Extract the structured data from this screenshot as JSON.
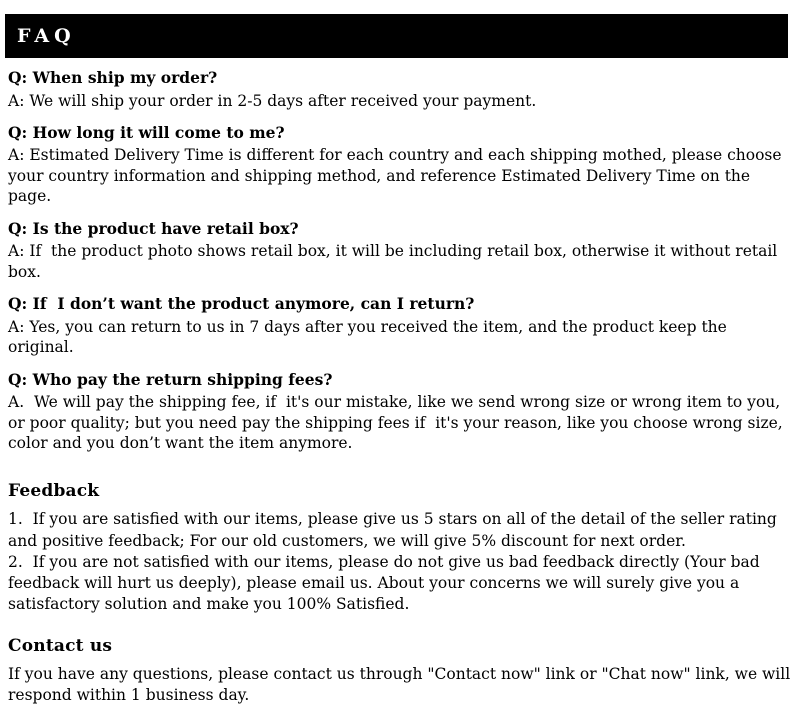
{
  "header": {
    "title": "FAQ",
    "background_color": "#000000",
    "text_color": "#ffffff"
  },
  "faq": {
    "items": [
      {
        "question": "Q: When ship my order?",
        "answer": "A: We will ship your order in 2-5 days after received your payment."
      },
      {
        "question": "Q: How long it will come to me?",
        "answer": "A: Estimated Delivery Time is different for each country and each shipping mothed, please choose your country information and shipping method, and reference Estimated Delivery Time on the page."
      },
      {
        "question": "Q: Is the product have retail box?",
        "answer": "A: If  the product photo shows retail box, it will be including retail box, otherwise it without retail box."
      },
      {
        "question": "Q: If  I don’t want the product anymore, can I return?",
        "answer": "A: Yes, you can return to us in 7 days after you received the item, and the product keep the original."
      },
      {
        "question": "Q: Who pay the return shipping fees?",
        "answer": "A.  We will pay the shipping fee, if  it's our mistake, like we send wrong size or wrong item to you, or poor quality; but you need pay the shipping fees if  it's your reason, like you choose wrong size, color and you don’t want the item anymore."
      }
    ]
  },
  "feedback": {
    "heading": "Feedback",
    "point_one": "1.  If you are satisfied with our items, please give us 5 stars on all of the detail of the seller rating and positive feedback; For our old customers, we will give 5% discount for next order.",
    "point_two": "2.  If you are not satisfied with our items, please do not give us bad feedback directly (Your bad feedback will hurt us deeply), please email us. About your concerns we will surely give you a satisfactory solution and make you 100% Satisfied."
  },
  "contact": {
    "heading": "Contact us",
    "body": "If you have any questions, please contact us through \"Contact now\" link or \"Chat now\" link, we will respond within 1 business day."
  }
}
